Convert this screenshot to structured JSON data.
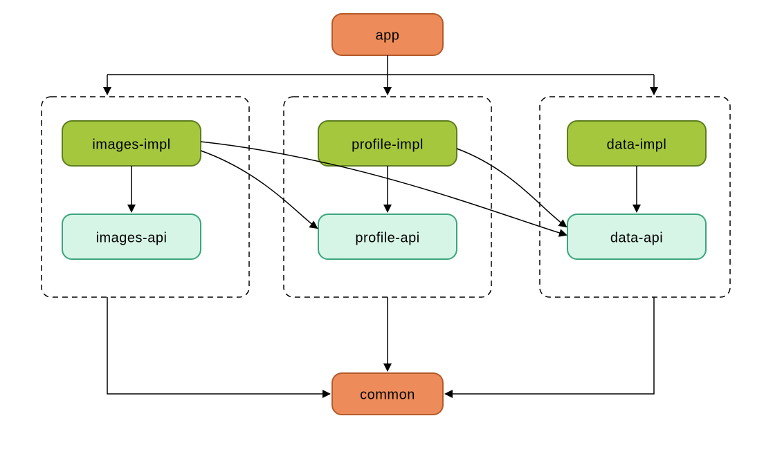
{
  "diagram": {
    "nodes": {
      "app": {
        "label": "app",
        "fill": "#ed8c5a",
        "stroke": "#b35a2a"
      },
      "images_impl": {
        "label": "images-impl",
        "fill": "#a5c73e",
        "stroke": "#5d7d1f"
      },
      "images_api": {
        "label": "images-api",
        "fill": "#d6f5e6",
        "stroke": "#3aa57d"
      },
      "profile_impl": {
        "label": "profile-impl",
        "fill": "#a5c73e",
        "stroke": "#5d7d1f"
      },
      "profile_api": {
        "label": "profile-api",
        "fill": "#d6f5e6",
        "stroke": "#3aa57d"
      },
      "data_impl": {
        "label": "data-impl",
        "fill": "#a5c73e",
        "stroke": "#5d7d1f"
      },
      "data_api": {
        "label": "data-api",
        "fill": "#d6f5e6",
        "stroke": "#3aa57d"
      },
      "common": {
        "label": "common",
        "fill": "#ed8c5a",
        "stroke": "#b35a2a"
      }
    },
    "groups": [
      "images",
      "profile",
      "data"
    ],
    "edges": [
      [
        "app",
        "images-group"
      ],
      [
        "app",
        "profile-group"
      ],
      [
        "app",
        "data-group"
      ],
      [
        "images-impl",
        "images-api"
      ],
      [
        "profile-impl",
        "profile-api"
      ],
      [
        "data-impl",
        "data-api"
      ],
      [
        "images-impl",
        "profile-api"
      ],
      [
        "images-impl",
        "data-api"
      ],
      [
        "profile-impl",
        "data-api"
      ],
      [
        "images-group",
        "common"
      ],
      [
        "profile-group",
        "common"
      ],
      [
        "data-group",
        "common"
      ]
    ]
  }
}
